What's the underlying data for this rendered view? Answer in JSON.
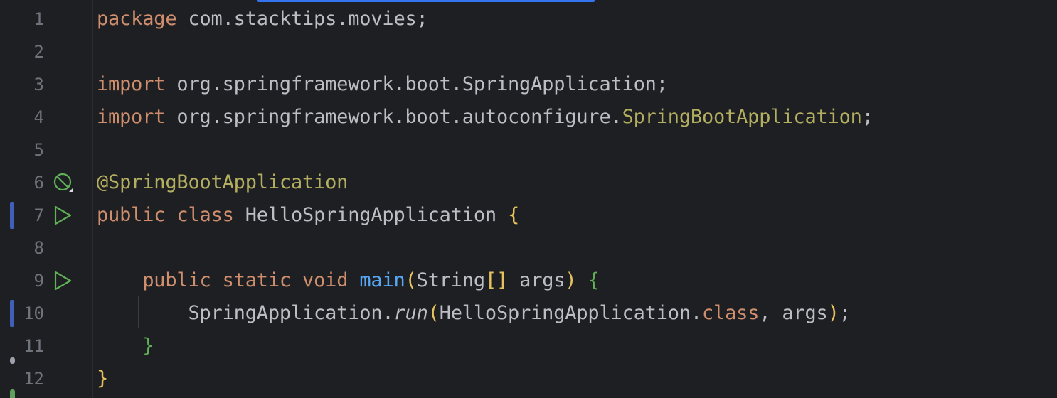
{
  "editor": {
    "lines": [
      {
        "number": "1",
        "segments": [
          {
            "text": "package",
            "cls": "kw"
          },
          {
            "text": " com.stacktips.movies;",
            "cls": ""
          }
        ]
      },
      {
        "number": "2",
        "segments": []
      },
      {
        "number": "3",
        "segments": [
          {
            "text": "import",
            "cls": "kw"
          },
          {
            "text": " org.springframework.boot.SpringApplication;",
            "cls": ""
          }
        ]
      },
      {
        "number": "4",
        "segments": [
          {
            "text": "import",
            "cls": "kw"
          },
          {
            "text": " org.springframework.boot.autoconfigure.",
            "cls": ""
          },
          {
            "text": "SpringBootApplication",
            "cls": "ann"
          },
          {
            "text": ";",
            "cls": ""
          }
        ]
      },
      {
        "number": "5",
        "segments": []
      },
      {
        "number": "6",
        "gutter_icon": "spring-bean-icon",
        "segments": [
          {
            "text": "@SpringBootApplication",
            "cls": "ann"
          }
        ]
      },
      {
        "number": "7",
        "gutter_icon": "run-icon",
        "changed": true,
        "segments": [
          {
            "text": "public",
            "cls": "kw"
          },
          {
            "text": " ",
            "cls": ""
          },
          {
            "text": "class",
            "cls": "kw"
          },
          {
            "text": " HelloSpringApplication ",
            "cls": ""
          },
          {
            "text": "{",
            "cls": "br1"
          }
        ]
      },
      {
        "number": "8",
        "segments": []
      },
      {
        "number": "9",
        "gutter_icon": "run-icon",
        "segments": [
          {
            "text": "    ",
            "cls": ""
          },
          {
            "text": "public",
            "cls": "kw"
          },
          {
            "text": " ",
            "cls": ""
          },
          {
            "text": "static",
            "cls": "kw"
          },
          {
            "text": " ",
            "cls": ""
          },
          {
            "text": "void",
            "cls": "kw"
          },
          {
            "text": " ",
            "cls": ""
          },
          {
            "text": "main",
            "cls": "fn"
          },
          {
            "text": "(",
            "cls": "br1"
          },
          {
            "text": "String",
            "cls": ""
          },
          {
            "text": "[]",
            "cls": "br1"
          },
          {
            "text": " args",
            "cls": ""
          },
          {
            "text": ")",
            "cls": "br1"
          },
          {
            "text": " ",
            "cls": ""
          },
          {
            "text": "{",
            "cls": "br2"
          }
        ]
      },
      {
        "number": "10",
        "changed": true,
        "segments": [
          {
            "text": "        SpringApplication.",
            "cls": ""
          },
          {
            "text": "run",
            "cls": "it"
          },
          {
            "text": "(",
            "cls": "br1"
          },
          {
            "text": "HelloSpringApplication.",
            "cls": ""
          },
          {
            "text": "class",
            "cls": "kw"
          },
          {
            "text": ", args",
            "cls": ""
          },
          {
            "text": ")",
            "cls": "br1"
          },
          {
            "text": ";",
            "cls": ""
          }
        ]
      },
      {
        "number": "11",
        "segments": [
          {
            "text": "    ",
            "cls": ""
          },
          {
            "text": "}",
            "cls": "br2"
          }
        ]
      },
      {
        "number": "12",
        "segments": [
          {
            "text": "}",
            "cls": "br1"
          }
        ]
      }
    ]
  },
  "colors": {
    "background": "#1e1f22",
    "keyword": "#cf8e6d",
    "annotation": "#b3ae60",
    "function": "#56a8f5",
    "bracket_yellow": "#e6c25d",
    "bracket_green": "#5fb056",
    "change_marker": "#3f5fb8",
    "run_icon": "#5fb056"
  }
}
